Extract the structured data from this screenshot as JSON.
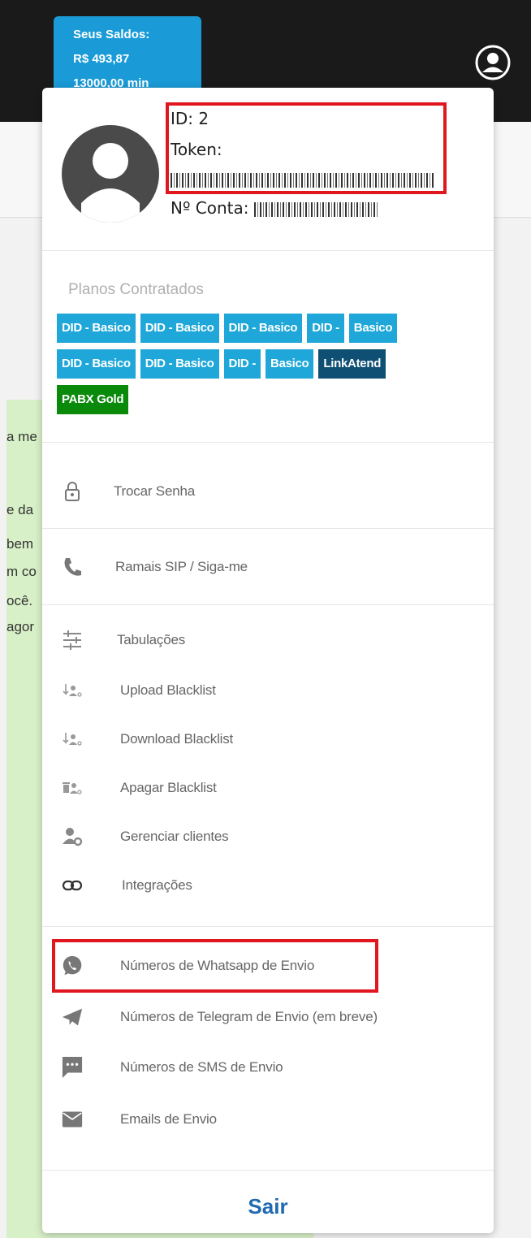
{
  "header": {
    "saldos_title": "Seus Saldos:",
    "saldo_value": "R$ 493,87",
    "saldo_minutes": "13000,00 min"
  },
  "background_text": [
    "a me",
    "e da",
    "bem",
    "m co",
    "ocê.",
    "agor"
  ],
  "profile": {
    "id_label": "ID: 2",
    "token_label": "Token:",
    "conta_label": "Nº Conta:"
  },
  "plans": {
    "title": "Planos Contratados",
    "tags": [
      {
        "label": "DID - Basico",
        "variant": "blue"
      },
      {
        "label": "DID - Basico",
        "variant": "blue"
      },
      {
        "label": "DID - Basico",
        "variant": "blue"
      },
      {
        "label": "DID -",
        "variant": "blue"
      },
      {
        "label": "Basico",
        "variant": "blue"
      },
      {
        "label": "DID - Basico",
        "variant": "blue"
      },
      {
        "label": "DID - Basico",
        "variant": "blue"
      },
      {
        "label": "DID -",
        "variant": "blue"
      },
      {
        "label": "Basico",
        "variant": "blue"
      },
      {
        "label": "LinkAtend",
        "variant": "dark"
      },
      {
        "label": "PABX Gold",
        "variant": "green"
      }
    ]
  },
  "menu": {
    "trocar_senha": "Trocar Senha",
    "ramais": "Ramais SIP / Siga-me",
    "tabulacoes": "Tabulações",
    "upload_blacklist": "Upload Blacklist",
    "download_blacklist": "Download Blacklist",
    "apagar_blacklist": "Apagar Blacklist",
    "gerenciar_clientes": "Gerenciar clientes",
    "integracoes": "Integrações",
    "whatsapp": "Números de Whatsapp de Envio",
    "telegram": "Números de Telegram de Envio (em breve)",
    "sms": "Números de SMS de Envio",
    "emails": "Emails de Envio"
  },
  "logout_label": "Sair",
  "colors": {
    "saldo_bg": "#1a9bd7",
    "tag_blue": "#1ea7d8",
    "tag_dark": "#0e4f73",
    "tag_green": "#0a8a0a",
    "highlight": "#e0171f",
    "logout": "#1f6ab0"
  }
}
